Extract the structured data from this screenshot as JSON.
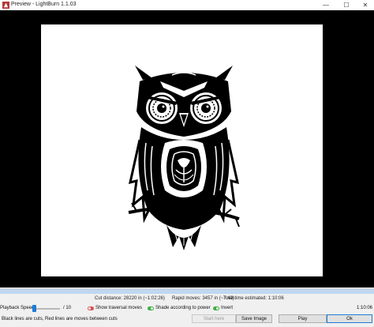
{
  "window": {
    "title": "Preview - LightBurn 1.1.03",
    "controls": {
      "minimize": "—",
      "maximize": "☐",
      "close": "✕"
    }
  },
  "icons": {
    "app": "lightburn-logo-icon",
    "owl": "owl-artwork-image"
  },
  "colors": {
    "background": "#000000",
    "page": "#ffffff",
    "accent": "#1e7bd6",
    "toggle_on": "#3cb043",
    "toggle_off": "#d9534f"
  },
  "stats": {
    "cut_distance": "Cut distance: 28220 in (~1:02:26)",
    "rapid_moves": "Rapid moves: 3457 in (~7:40)",
    "total_time": "Total time estimated: 1:10:06"
  },
  "playback": {
    "label": "Playback Speed",
    "max": "/ 10",
    "time": "1:10:06",
    "progress_fraction": 1.0,
    "toggles": [
      {
        "label": "Show traversal moves",
        "state": "off"
      },
      {
        "label": "Shade according to power",
        "state": "on"
      },
      {
        "label": "Invert",
        "state": "on"
      }
    ]
  },
  "footer": {
    "legend": "Black lines are cuts, Red lines are moves between cuts",
    "buttons": {
      "start": "Start here",
      "save": "Save Image",
      "play": "Play",
      "ok": "Ok"
    }
  }
}
